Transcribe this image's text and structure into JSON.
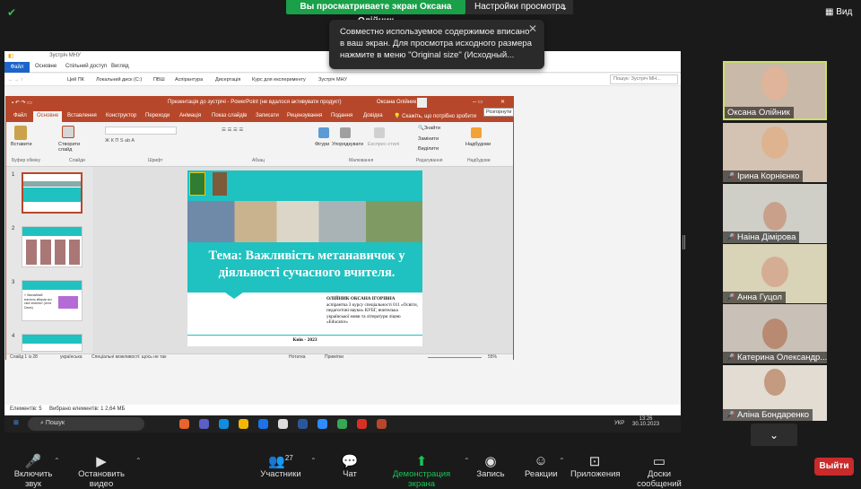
{
  "zoom": {
    "viewing_banner": "Вы просматриваете экран Оксана Олійник",
    "view_options": "Настройки просмотра",
    "view_button": "Вид",
    "tooltip": "Совместно используемое содержимое вписано в ваш экран. Для просмотра исходного размера нажмите в меню \"Original size\" (Исходный...",
    "participants": [
      {
        "name": "Оксана Олійник",
        "muted": false
      },
      {
        "name": "Ірина Корнієнко",
        "muted": true
      },
      {
        "name": "Наіна Дімірова",
        "muted": true
      },
      {
        "name": "Анна Гуцол",
        "muted": true
      },
      {
        "name": "Катерина Олександр...",
        "muted": true
      },
      {
        "name": "Аліна Бондаренко",
        "muted": true
      }
    ],
    "controls": {
      "unmute": "Включить звук",
      "video": "Остановить видео",
      "participants": "Участники",
      "participants_count": "27",
      "chat": "Чат",
      "share": "Демонстрация экрана",
      "record": "Запись",
      "reactions": "Реакции",
      "apps": "Приложения",
      "whiteboards": "Доски сообщений",
      "leave": "Выйти"
    }
  },
  "explorer": {
    "window_title": "Зустріч МНУ",
    "tabs": [
      "Файл",
      "Основне",
      "Спільний доступ",
      "Вигляд"
    ],
    "breadcrumbs": [
      "Цей ПК",
      "Локальний диск (C:)",
      "ПВШ",
      "Аспірантура",
      "Дисертація",
      "Курс для експерименту",
      "Зустріч МНУ"
    ],
    "search_placeholder": "Пошук: Зустріч МН...",
    "status_items": "Елементів: 5",
    "status_selected": "Вибрано елементів: 1  2,64 МБ"
  },
  "powerpoint": {
    "title": "Презентація до зустрічі  -  PowerPoint (не вдалося активувати продукт)",
    "user": "Оксана Олійник",
    "restore_tooltip": "Розгорнути",
    "tabs": [
      "Файл",
      "Основне",
      "Вставлення",
      "Конструктор",
      "Переходи",
      "Анімація",
      "Показ слайдів",
      "Записати",
      "Рецензування",
      "Подання",
      "Довідка"
    ],
    "active_tab": "Основне",
    "tell_me": "Скажіть, що потрібно зробити",
    "ribbon": {
      "paste": "Вставити",
      "new_slide": "Створити слайд",
      "shapes": "Фігури",
      "arrange": "Упорядкувати",
      "quick_styles": "Експрес-стилі",
      "find": "Знайти",
      "replace": "Замінити",
      "select": "Виділити",
      "designer": "Надбудови",
      "groups": [
        "Буфер обміну",
        "Слайди",
        "Шрифт",
        "Абзац",
        "Малювання",
        "Редагування",
        "Надбудови"
      ]
    },
    "thumb_numbers": [
      "1",
      "2",
      "3",
      "4"
    ],
    "thumb3_text": "« Звичайний вчитель вбирає всі свої знання»  (Uma Davis)",
    "slide": {
      "title": "Тема: Важливість метанавичок у діяльності сучасного вчителя.",
      "author_name": "ОЛІЙНИК ОКСАНА ІГОРІВНА",
      "author_desc": "аспірантка 3 курсу спеціальності 011 «Освіти, педагогічні науки» КУБГ, вчителька української мови та літератури ліцею «Educator»",
      "footer": "Київ - 2023"
    },
    "status": {
      "slide": "Слайд 1 із 28",
      "language": "українська",
      "accessibility": "Спеціальні можливості: щось не так",
      "notes": "Нотатка",
      "comments": "Примітки",
      "zoom": "55%"
    }
  },
  "taskbar": {
    "search": "Пошук",
    "lang": "УКР",
    "time": "13:26",
    "date": "30.10.2023"
  },
  "colors": {
    "ppt_accent": "#b7472a",
    "slide_teal": "#1fc2c0",
    "zoom_green": "#19a049",
    "leave_red": "#c92a2a"
  }
}
